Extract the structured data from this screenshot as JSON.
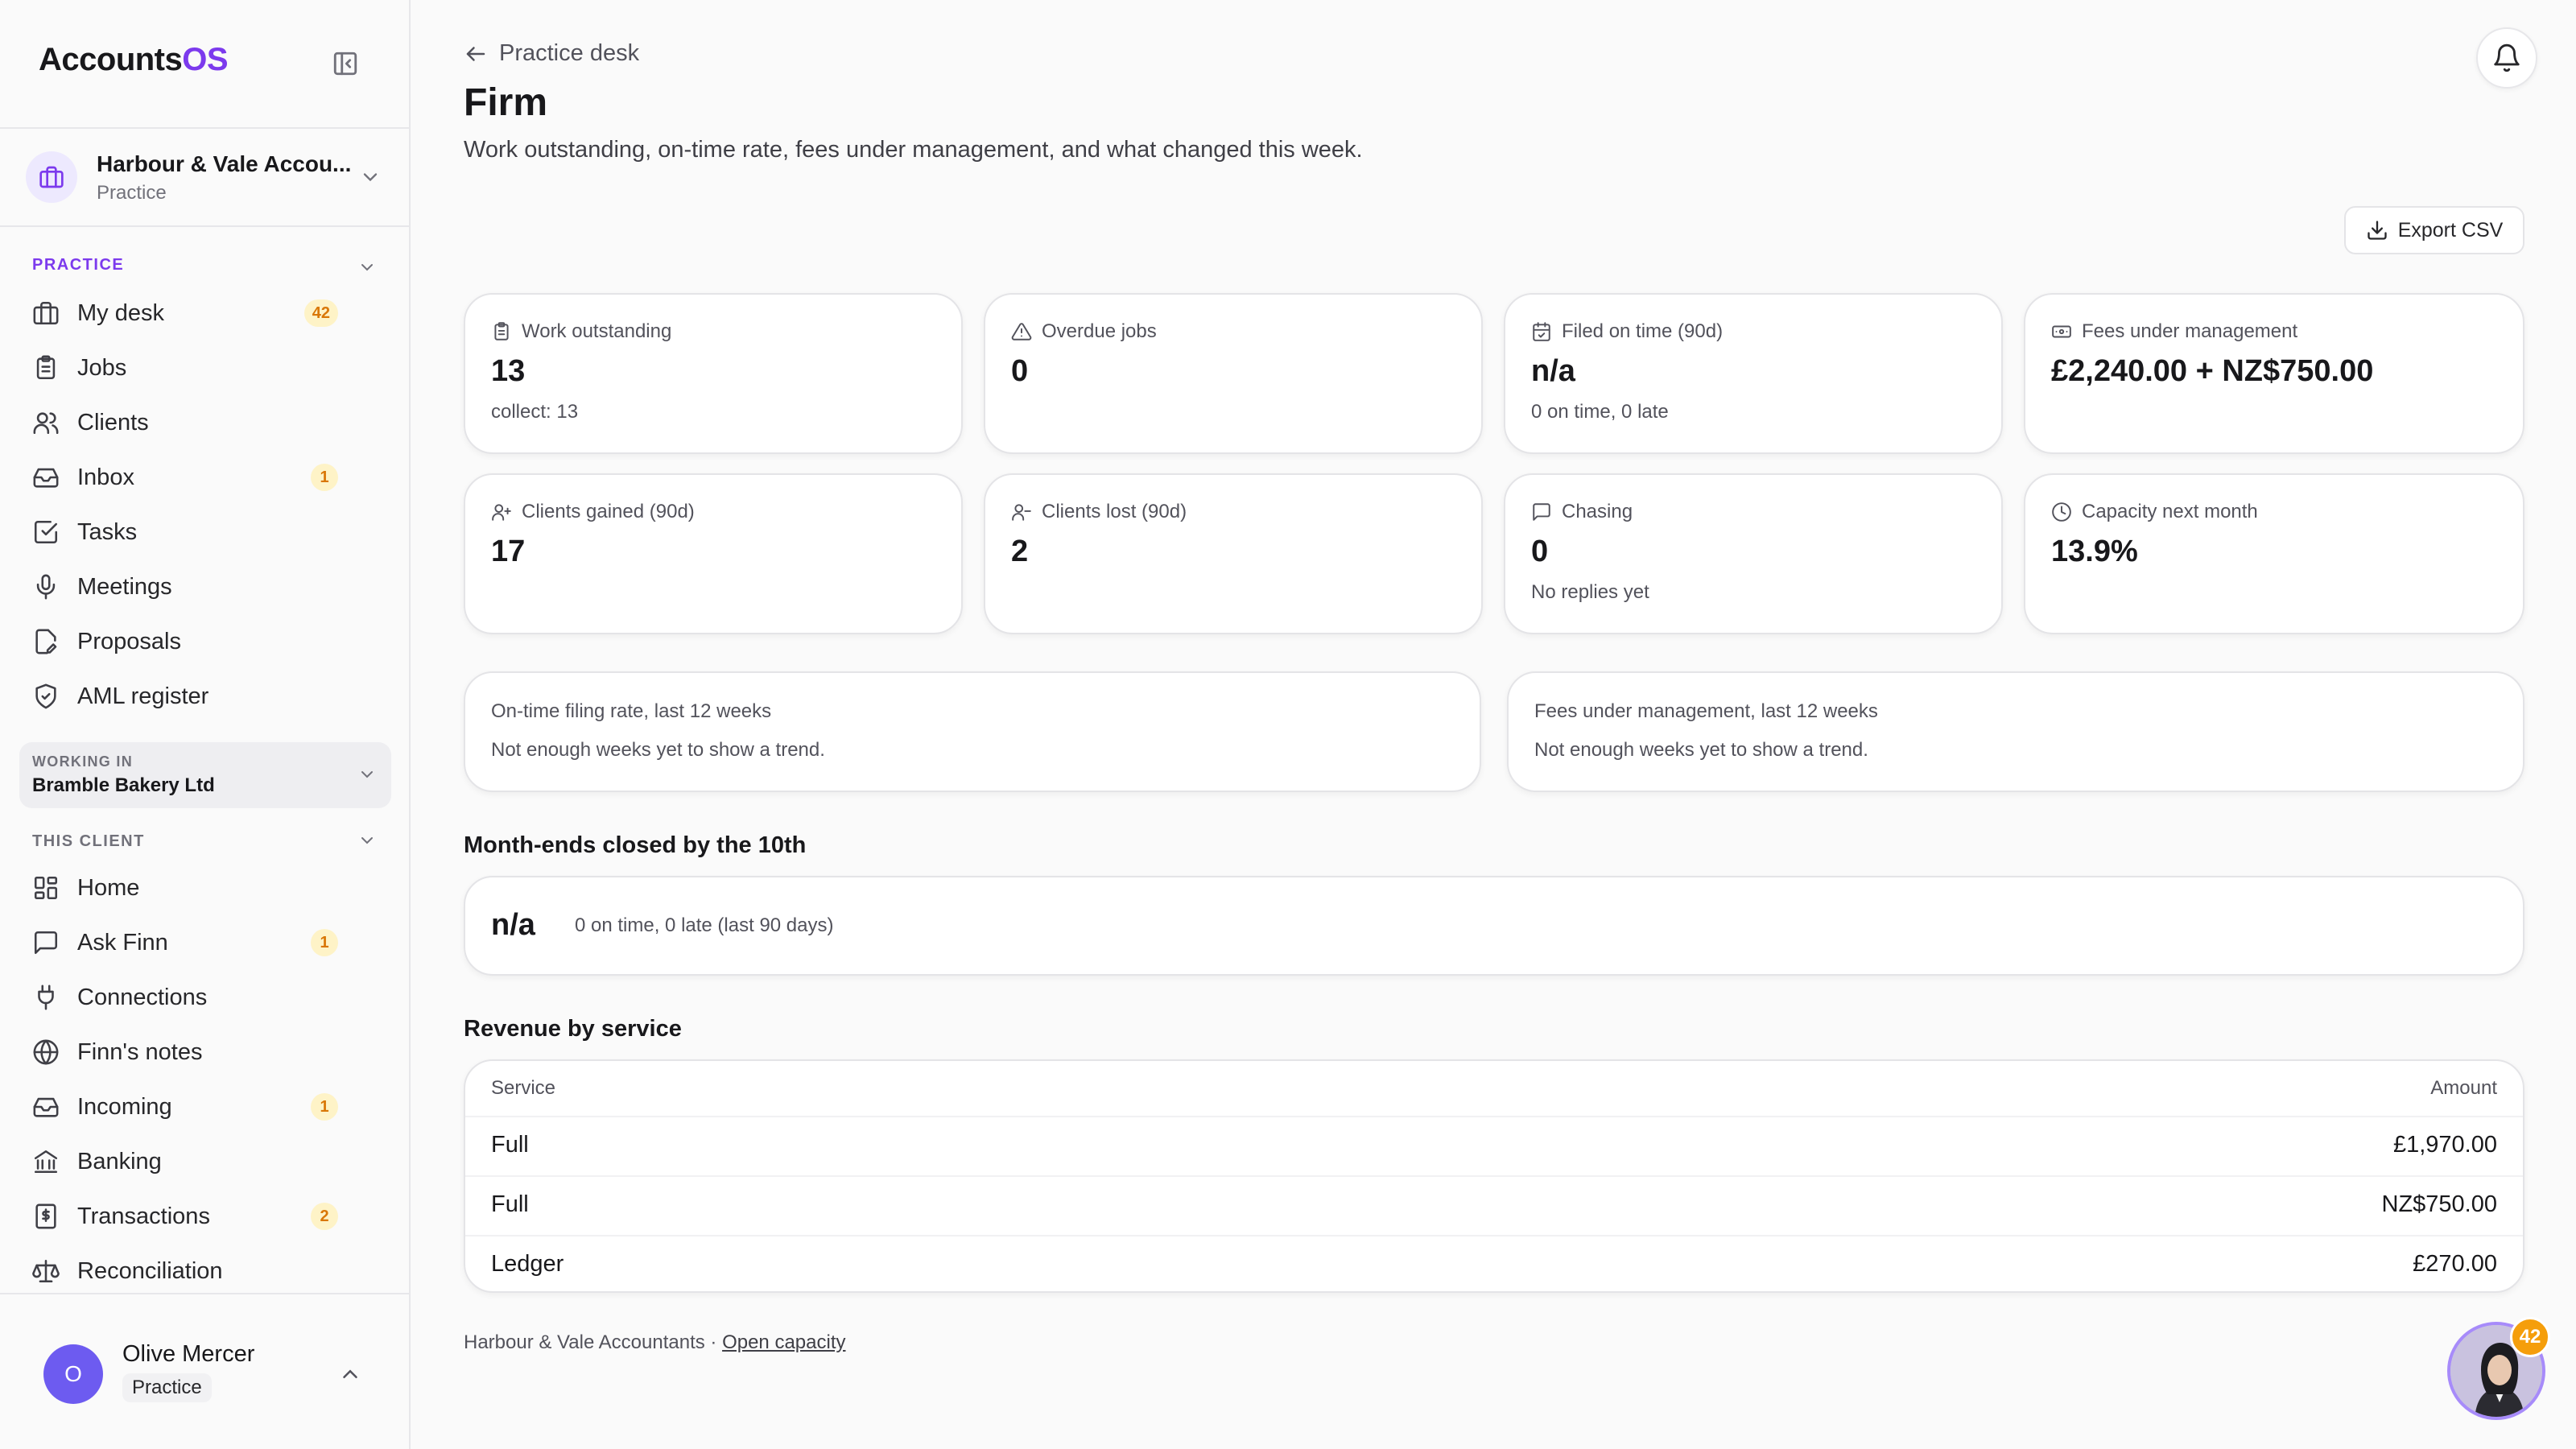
{
  "brand": {
    "name_main": "Accounts",
    "name_accent": "OS"
  },
  "org": {
    "name": "Harbour & Vale Accou...",
    "type": "Practice"
  },
  "sidebar": {
    "practice_label": "PRACTICE",
    "practice_items": [
      {
        "label": "My desk",
        "badge": "42",
        "icon": "briefcase-icon"
      },
      {
        "label": "Jobs",
        "badge": "",
        "icon": "clipboard-icon"
      },
      {
        "label": "Clients",
        "badge": "",
        "icon": "users-icon"
      },
      {
        "label": "Inbox",
        "badge": "1",
        "icon": "inbox-icon"
      },
      {
        "label": "Tasks",
        "badge": "",
        "icon": "checkbox-icon"
      },
      {
        "label": "Meetings",
        "badge": "",
        "icon": "microphone-icon"
      },
      {
        "label": "Proposals",
        "badge": "",
        "icon": "document-edit-icon"
      },
      {
        "label": "AML register",
        "badge": "",
        "icon": "shield-icon"
      }
    ],
    "working_in_label": "WORKING IN",
    "working_in_client": "Bramble Bakery Ltd",
    "client_label": "THIS CLIENT",
    "client_items": [
      {
        "label": "Home",
        "badge": "",
        "icon": "grid-icon"
      },
      {
        "label": "Ask Finn",
        "badge": "1",
        "icon": "chat-icon"
      },
      {
        "label": "Connections",
        "badge": "",
        "icon": "plug-icon"
      },
      {
        "label": "Finn's notes",
        "badge": "",
        "icon": "globe-icon"
      },
      {
        "label": "Incoming",
        "badge": "1",
        "icon": "inbox-icon"
      },
      {
        "label": "Banking",
        "badge": "",
        "icon": "bank-icon"
      },
      {
        "label": "Transactions",
        "badge": "2",
        "icon": "receipt-icon"
      },
      {
        "label": "Reconciliation",
        "badge": "",
        "icon": "scale-icon"
      }
    ]
  },
  "user": {
    "initial": "O",
    "name": "Olive Mercer",
    "role": "Practice"
  },
  "header": {
    "back_label": "Practice desk",
    "title": "Firm",
    "subtitle": "Work outstanding, on-time rate, fees under management, and what changed this week.",
    "export_label": "Export CSV"
  },
  "stats": [
    {
      "label": "Work outstanding",
      "value": "13",
      "sub": "collect: 13",
      "icon": "clipboard-icon"
    },
    {
      "label": "Overdue jobs",
      "value": "0",
      "sub": "",
      "icon": "warning-icon"
    },
    {
      "label": "Filed on time (90d)",
      "value": "n/a",
      "sub": "0 on time, 0 late",
      "icon": "calendar-icon"
    },
    {
      "label": "Fees under management",
      "value": "£2,240.00 + NZ$750.00",
      "sub": "",
      "icon": "banknote-icon"
    },
    {
      "label": "Clients gained (90d)",
      "value": "17",
      "sub": "",
      "icon": "user-plus-icon"
    },
    {
      "label": "Clients lost (90d)",
      "value": "2",
      "sub": "",
      "icon": "user-minus-icon"
    },
    {
      "label": "Chasing",
      "value": "0",
      "sub": "No replies yet",
      "icon": "chat-icon"
    },
    {
      "label": "Capacity next month",
      "value": "13.9%",
      "sub": "",
      "icon": "clock-icon"
    }
  ],
  "trends": [
    {
      "title": "On-time filing rate, last 12 weeks",
      "text": "Not enough weeks yet to show a trend."
    },
    {
      "title": "Fees under management, last 12 weeks",
      "text": "Not enough weeks yet to show a trend."
    }
  ],
  "month_ends": {
    "heading": "Month-ends closed by the 10th",
    "value": "n/a",
    "text": "0 on time, 0 late (last 90 days)"
  },
  "revenue": {
    "heading": "Revenue by service",
    "columns": [
      "Service",
      "Amount"
    ],
    "rows": [
      {
        "service": "Full",
        "amount": "£1,970.00"
      },
      {
        "service": "Full",
        "amount": "NZ$750.00"
      },
      {
        "service": "Ledger",
        "amount": "£270.00"
      }
    ]
  },
  "footer": {
    "text": "Harbour & Vale Accountants · ",
    "link": "Open capacity"
  },
  "finn": {
    "badge": "42"
  },
  "colors": {
    "accent": "#7c3aed",
    "badge_bg": "#fef3c7",
    "badge_text": "#d97706",
    "avatar": "#6d5bf0"
  }
}
